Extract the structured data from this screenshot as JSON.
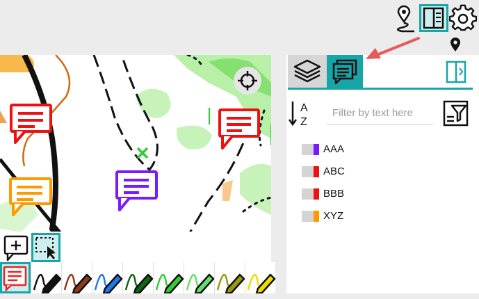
{
  "top_bar": {
    "icons": [
      "location-route-icon",
      "panel-toggle-icon",
      "gear-icon",
      "location-pin-icon"
    ]
  },
  "panel": {
    "tabs": [
      {
        "name": "layers",
        "icon": "layers-icon"
      },
      {
        "name": "notes",
        "icon": "chat-bubbles-icon",
        "active": true
      }
    ],
    "filter": {
      "placeholder": "Filter by text here"
    },
    "layers": [
      {
        "label": "AAA",
        "color": "#7a1aff"
      },
      {
        "label": "ABC",
        "color": "#ee1111"
      },
      {
        "label": "BBB",
        "color": "#ee1111"
      },
      {
        "label": "XYZ",
        "color": "#ff9900"
      }
    ]
  },
  "toolbar": {
    "pens": [
      {
        "name": "note-tool",
        "color": "#ee2222"
      },
      {
        "name": "pen-black",
        "color": "#111111"
      },
      {
        "name": "pen-brown",
        "color": "#8b3a1a"
      },
      {
        "name": "pen-blue",
        "color": "#2277ee"
      },
      {
        "name": "pen-dark-green",
        "color": "#116611"
      },
      {
        "name": "pen-green",
        "color": "#33cc33"
      },
      {
        "name": "pen-light-green",
        "color": "#66dd66"
      },
      {
        "name": "pen-olive",
        "color": "#999911"
      },
      {
        "name": "pen-yellow",
        "color": "#eedd00"
      }
    ]
  },
  "colors": {
    "accent": "#18a5a8",
    "arrow": "#e85a5a"
  }
}
